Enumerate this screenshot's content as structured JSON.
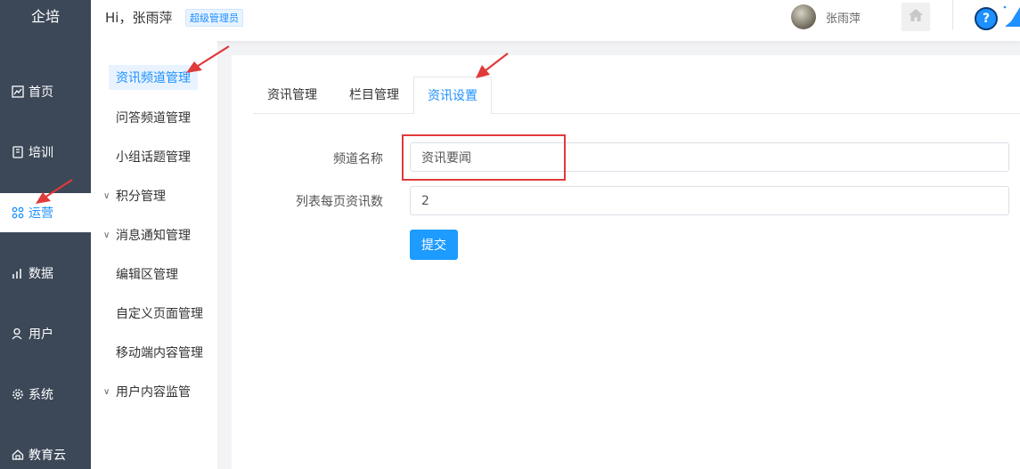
{
  "app": {
    "brand": "企培"
  },
  "rail": {
    "items": [
      {
        "label": "首页",
        "icon": "chart-line-icon"
      },
      {
        "label": "培训",
        "icon": "book-icon"
      },
      {
        "label": "运营",
        "icon": "operations-icon",
        "active": true
      },
      {
        "label": "数据",
        "icon": "bar-chart-icon"
      },
      {
        "label": "用户",
        "icon": "user-icon"
      },
      {
        "label": "系统",
        "icon": "gear-icon"
      },
      {
        "label": "教育云",
        "icon": "cloud-icon"
      }
    ]
  },
  "header": {
    "greeting": "Hi，张雨萍",
    "role_badge": "超级管理员",
    "username": "张雨萍",
    "help": "?"
  },
  "subnav": {
    "items": [
      {
        "label": "资讯频道管理",
        "active": true,
        "expandable": false
      },
      {
        "label": "问答频道管理",
        "expandable": false
      },
      {
        "label": "小组话题管理",
        "expandable": false
      },
      {
        "label": "积分管理",
        "expandable": true
      },
      {
        "label": "消息通知管理",
        "expandable": true
      },
      {
        "label": "编辑区管理",
        "expandable": false
      },
      {
        "label": "自定义页面管理",
        "expandable": false
      },
      {
        "label": "移动端内容管理",
        "expandable": false
      },
      {
        "label": "用户内容监管",
        "expandable": true
      }
    ]
  },
  "tabs": [
    {
      "label": "资讯管理"
    },
    {
      "label": "栏目管理"
    },
    {
      "label": "资讯设置",
      "active": true
    }
  ],
  "form": {
    "channel_name_label": "频道名称",
    "channel_name_value": "资讯要闻",
    "per_page_label": "列表每页资讯数",
    "per_page_value": "2",
    "submit_label": "提交"
  },
  "colors": {
    "rail_bg": "#3c4858",
    "accent": "#1e90ff",
    "annotation": "#e03a3a"
  }
}
